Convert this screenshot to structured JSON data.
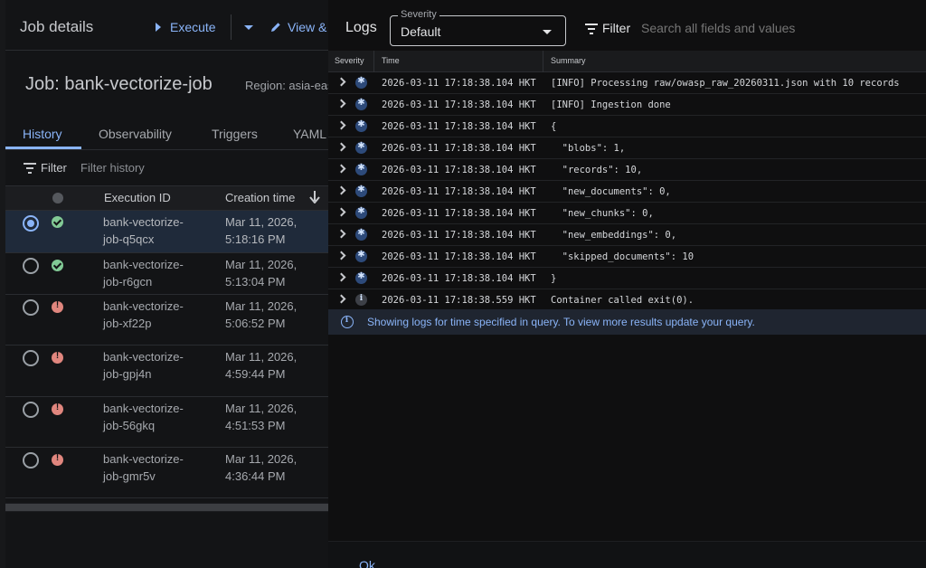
{
  "header": {
    "title": "Job details",
    "execute_label": "Execute",
    "view_label": "View &"
  },
  "job": {
    "title": "Job: bank-vectorize-job",
    "region": "Region: asia-eas"
  },
  "tabs": [
    {
      "label": "History"
    },
    {
      "label": "Observability"
    },
    {
      "label": "Triggers"
    },
    {
      "label": "YAML"
    }
  ],
  "history_filter": {
    "label": "Filter",
    "placeholder": "Filter history"
  },
  "history_table": {
    "col_execution_id": "Execution ID",
    "col_creation_time": "Creation time",
    "rows": [
      {
        "id_line1": "bank-vectorize-",
        "id_line2": "job-q5qcx",
        "time_line1": "Mar 11, 2026,",
        "time_line2": "5:18:16 PM",
        "status": "success",
        "selected": true
      },
      {
        "id_line1": "bank-vectorize-",
        "id_line2": "job-r6gcn",
        "time_line1": "Mar 11, 2026,",
        "time_line2": "5:13:04 PM",
        "status": "success",
        "selected": false
      },
      {
        "id_line1": "bank-vectorize-",
        "id_line2": "job-xf22p",
        "time_line1": "Mar 11, 2026,",
        "time_line2": "5:06:52 PM",
        "status": "error",
        "selected": false
      },
      {
        "id_line1": "bank-vectorize-",
        "id_line2": "job-gpj4n",
        "time_line1": "Mar 11, 2026,",
        "time_line2": "4:59:44 PM",
        "status": "error",
        "selected": false
      },
      {
        "id_line1": "bank-vectorize-",
        "id_line2": "job-56gkq",
        "time_line1": "Mar 11, 2026,",
        "time_line2": "4:51:53 PM",
        "status": "error",
        "selected": false
      },
      {
        "id_line1": "bank-vectorize-",
        "id_line2": "job-gmr5v",
        "time_line1": "Mar 11, 2026,",
        "time_line2": "4:36:44 PM",
        "status": "error",
        "selected": false
      }
    ]
  },
  "logs": {
    "title": "Logs",
    "severity_legend": "Severity",
    "severity_value": "Default",
    "filter_label": "Filter",
    "search_placeholder": "Search all fields and values",
    "columns": {
      "severity": "Severity",
      "time": "Time",
      "summary": "Summary"
    },
    "entries": [
      {
        "severity": "debug",
        "time": "2026-03-11 17:18:38.104 HKT",
        "summary": "[INFO] Processing raw/owasp_raw_20260311.json with 10 records"
      },
      {
        "severity": "debug",
        "time": "2026-03-11 17:18:38.104 HKT",
        "summary": "[INFO] Ingestion done"
      },
      {
        "severity": "debug",
        "time": "2026-03-11 17:18:38.104 HKT",
        "summary": "{"
      },
      {
        "severity": "debug",
        "time": "2026-03-11 17:18:38.104 HKT",
        "summary": "  \"blobs\": 1,"
      },
      {
        "severity": "debug",
        "time": "2026-03-11 17:18:38.104 HKT",
        "summary": "  \"records\": 10,"
      },
      {
        "severity": "debug",
        "time": "2026-03-11 17:18:38.104 HKT",
        "summary": "  \"new_documents\": 0,"
      },
      {
        "severity": "debug",
        "time": "2026-03-11 17:18:38.104 HKT",
        "summary": "  \"new_chunks\": 0,"
      },
      {
        "severity": "debug",
        "time": "2026-03-11 17:18:38.104 HKT",
        "summary": "  \"new_embeddings\": 0,"
      },
      {
        "severity": "debug",
        "time": "2026-03-11 17:18:38.104 HKT",
        "summary": "  \"skipped_documents\": 10"
      },
      {
        "severity": "debug",
        "time": "2026-03-11 17:18:38.104 HKT",
        "summary": "}"
      },
      {
        "severity": "info",
        "time": "2026-03-11 17:18:38.559 HKT",
        "summary": "Container called exit(0)."
      }
    ],
    "info_banner": "Showing logs for time specified in query. To view more results update your query.",
    "ok_label": "Ok"
  },
  "colors": {
    "accent": "#8ab4f8",
    "success": "#81c995",
    "error": "#e0867e"
  }
}
